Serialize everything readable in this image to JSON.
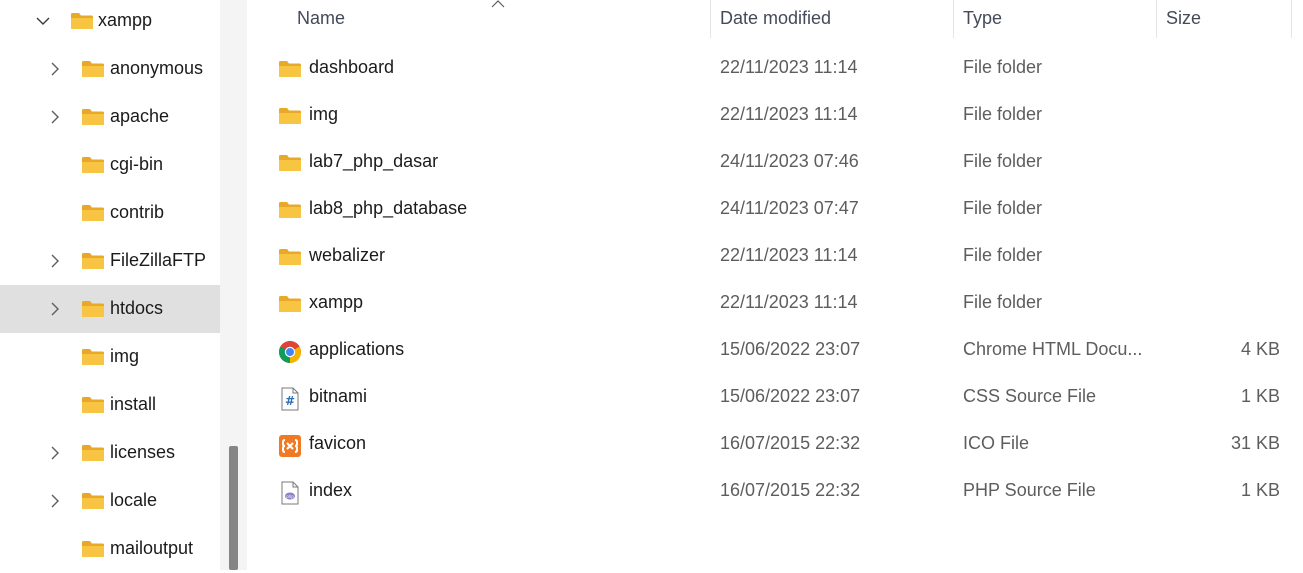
{
  "nav": {
    "items": [
      {
        "label": "xampp",
        "expander": "chevron-down-icon"
      },
      {
        "label": "anonymous",
        "expander": "chevron-right-icon"
      },
      {
        "label": "apache",
        "expander": "chevron-right-icon"
      },
      {
        "label": "cgi-bin",
        "expander": null
      },
      {
        "label": "contrib",
        "expander": null
      },
      {
        "label": "FileZillaFTP",
        "expander": "chevron-right-icon"
      },
      {
        "label": "htdocs",
        "expander": "chevron-right-icon",
        "selected": true
      },
      {
        "label": "img",
        "expander": null
      },
      {
        "label": "install",
        "expander": null
      },
      {
        "label": "licenses",
        "expander": "chevron-right-icon"
      },
      {
        "label": "locale",
        "expander": "chevron-right-icon"
      },
      {
        "label": "mailoutput",
        "expander": null
      }
    ]
  },
  "columns": {
    "name": "Name",
    "date": "Date modified",
    "type": "Type",
    "size": "Size"
  },
  "files": [
    {
      "name": "dashboard",
      "date": "22/11/2023 11:14",
      "type": "File folder",
      "size": "",
      "icon": "folder-icon"
    },
    {
      "name": "img",
      "date": "22/11/2023 11:14",
      "type": "File folder",
      "size": "",
      "icon": "folder-icon"
    },
    {
      "name": "lab7_php_dasar",
      "date": "24/11/2023 07:46",
      "type": "File folder",
      "size": "",
      "icon": "folder-icon"
    },
    {
      "name": "lab8_php_database",
      "date": "24/11/2023 07:47",
      "type": "File folder",
      "size": "",
      "icon": "folder-icon"
    },
    {
      "name": "webalizer",
      "date": "22/11/2023 11:14",
      "type": "File folder",
      "size": "",
      "icon": "folder-icon"
    },
    {
      "name": "xampp",
      "date": "22/11/2023 11:14",
      "type": "File folder",
      "size": "",
      "icon": "folder-icon"
    },
    {
      "name": "applications",
      "date": "15/06/2022 23:07",
      "type": "Chrome HTML Docu...",
      "size": "4 KB",
      "icon": "chrome-icon"
    },
    {
      "name": "bitnami",
      "date": "15/06/2022 23:07",
      "type": "CSS Source File",
      "size": "1 KB",
      "icon": "css-file-icon"
    },
    {
      "name": "favicon",
      "date": "16/07/2015 22:32",
      "type": "ICO File",
      "size": "31 KB",
      "icon": "xampp-ico-icon"
    },
    {
      "name": "index",
      "date": "16/07/2015 22:32",
      "type": "PHP Source File",
      "size": "1 KB",
      "icon": "php-file-icon"
    }
  ],
  "colors": {
    "folder": "#f8c543",
    "folder_dark": "#e8a92b",
    "selection": "#e0e0e0",
    "xampp": "#f07a24"
  }
}
